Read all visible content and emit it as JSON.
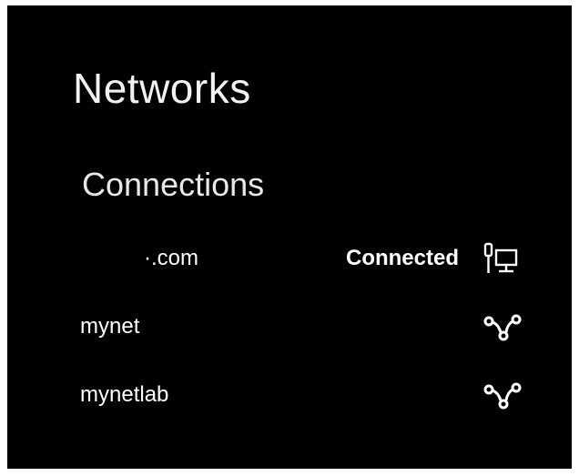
{
  "page": {
    "title": "Networks",
    "section_title": "Connections"
  },
  "connections": [
    {
      "name": "·.com",
      "status": "Connected",
      "icon": "wired-network-icon"
    },
    {
      "name": "mynet",
      "status": "",
      "icon": "wireless-link-icon"
    },
    {
      "name": "mynetlab",
      "status": "",
      "icon": "wireless-link-icon"
    }
  ]
}
